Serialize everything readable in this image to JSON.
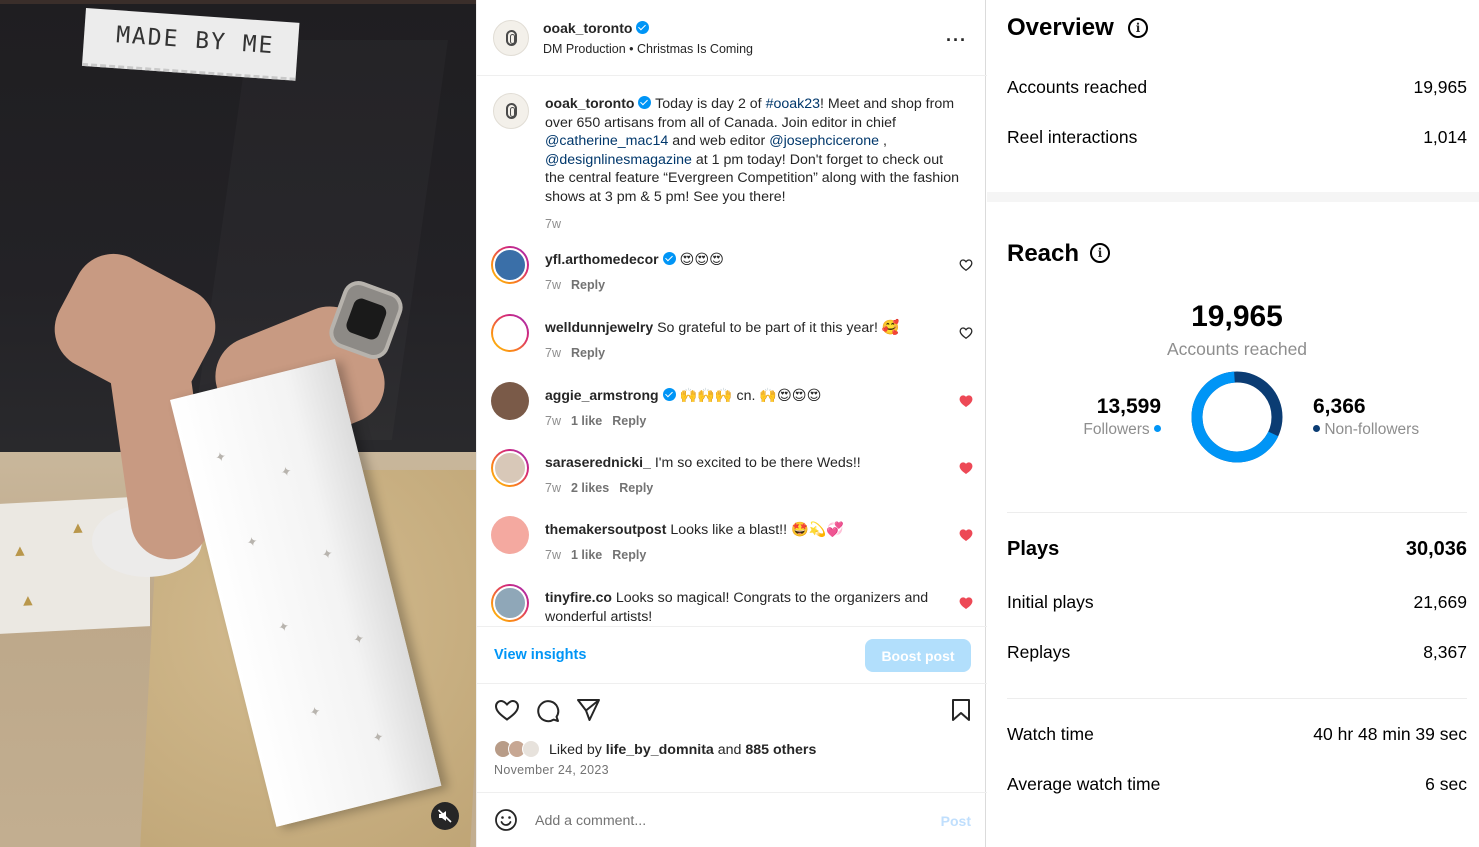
{
  "post": {
    "username": "ooak_toronto",
    "subtitle": "DM Production • Christmas Is Coming",
    "caption_user": "ooak_toronto",
    "caption_parts": [
      {
        "text": "Today is day 2 of ",
        "link": false
      },
      {
        "text": "#ooak23",
        "link": true
      },
      {
        "text": "! Meet and shop from over 650 artisans from all of Canada. Join editor in chief ",
        "link": false
      },
      {
        "text": "@catherine_mac14",
        "link": true
      },
      {
        "text": " and web editor ",
        "link": false
      },
      {
        "text": "@josephcicerone",
        "link": true
      },
      {
        "text": " , ",
        "link": false
      },
      {
        "text": "@designlinesmagazine",
        "link": true
      },
      {
        "text": " at 1 pm today! Don't forget to check out the central feature “Evergreen Competition” along with the fashion shows at 3 pm & 5 pm! See you there!",
        "link": false
      }
    ],
    "caption_time": "7w",
    "comments": [
      {
        "user": "yfl.arthomedecor",
        "verified": true,
        "text": "😍😍😍",
        "time": "7w",
        "likes": "",
        "reply": "Reply",
        "liked": false,
        "avatar_color": "#3a6fa8"
      },
      {
        "user": "welldunnjewelry",
        "verified": false,
        "text": "So grateful to be part of it this year! 🥰",
        "time": "7w",
        "likes": "",
        "reply": "Reply",
        "liked": false,
        "avatar_color": "#ffffff"
      },
      {
        "user": "aggie_armstrong",
        "verified": true,
        "text": "🙌🙌🙌 cn. 🙌😍😍😍",
        "time": "7w",
        "likes": "1 like",
        "reply": "Reply",
        "liked": true,
        "avatar_color": "#7a5a48"
      },
      {
        "user": "saraserednicki_",
        "verified": false,
        "text": "I'm so excited to be there Weds!!",
        "time": "7w",
        "likes": "2 likes",
        "reply": "Reply",
        "liked": true,
        "avatar_color": "#d8c8b8"
      },
      {
        "user": "themakersoutpost",
        "verified": false,
        "text": "Looks like a blast!! 🤩💫💞",
        "time": "7w",
        "likes": "1 like",
        "reply": "Reply",
        "liked": true,
        "avatar_color": "#f4a9a0"
      },
      {
        "user": "tinyfire.co",
        "verified": false,
        "text": "Looks so magical! Congrats to the organizers and wonderful artists!",
        "time": "",
        "likes": "",
        "reply": "",
        "liked": true,
        "avatar_color": "#8fa7b8"
      }
    ],
    "view_insights": "View insights",
    "boost_post": "Boost post",
    "liked_by_prefix": "Liked by ",
    "liked_by_user": "life_by_domnita",
    "liked_by_suffix": " and ",
    "liked_by_others": "885 others",
    "date": "November 24, 2023",
    "comment_placeholder": "Add a comment...",
    "post_button": "Post"
  },
  "video": {
    "tag_text": "MADE BY ME"
  },
  "insights": {
    "overview_title": "Overview",
    "overview_rows": [
      {
        "label": "Accounts reached",
        "value": "19,965"
      },
      {
        "label": "Reel interactions",
        "value": "1,014"
      }
    ],
    "reach_title": "Reach",
    "reach_total": "19,965",
    "reach_label": "Accounts reached",
    "followers_value": "13,599",
    "followers_label": "Followers",
    "non_followers_value": "6,366",
    "non_followers_label": "Non-followers",
    "followers_fraction": 0.681,
    "colors": {
      "followers": "#0095f6",
      "non_followers": "#0b3c73",
      "verified": "#0095f6",
      "liked_heart": "#ed4956"
    },
    "plays_label": "Plays",
    "plays_value": "30,036",
    "initial_plays_label": "Initial plays",
    "initial_plays_value": "21,669",
    "replays_label": "Replays",
    "replays_value": "8,367",
    "watch_time_label": "Watch time",
    "watch_time_value": "40 hr 48 min 39 sec",
    "avg_watch_time_label": "Average watch time",
    "avg_watch_time_value": "6 sec"
  }
}
